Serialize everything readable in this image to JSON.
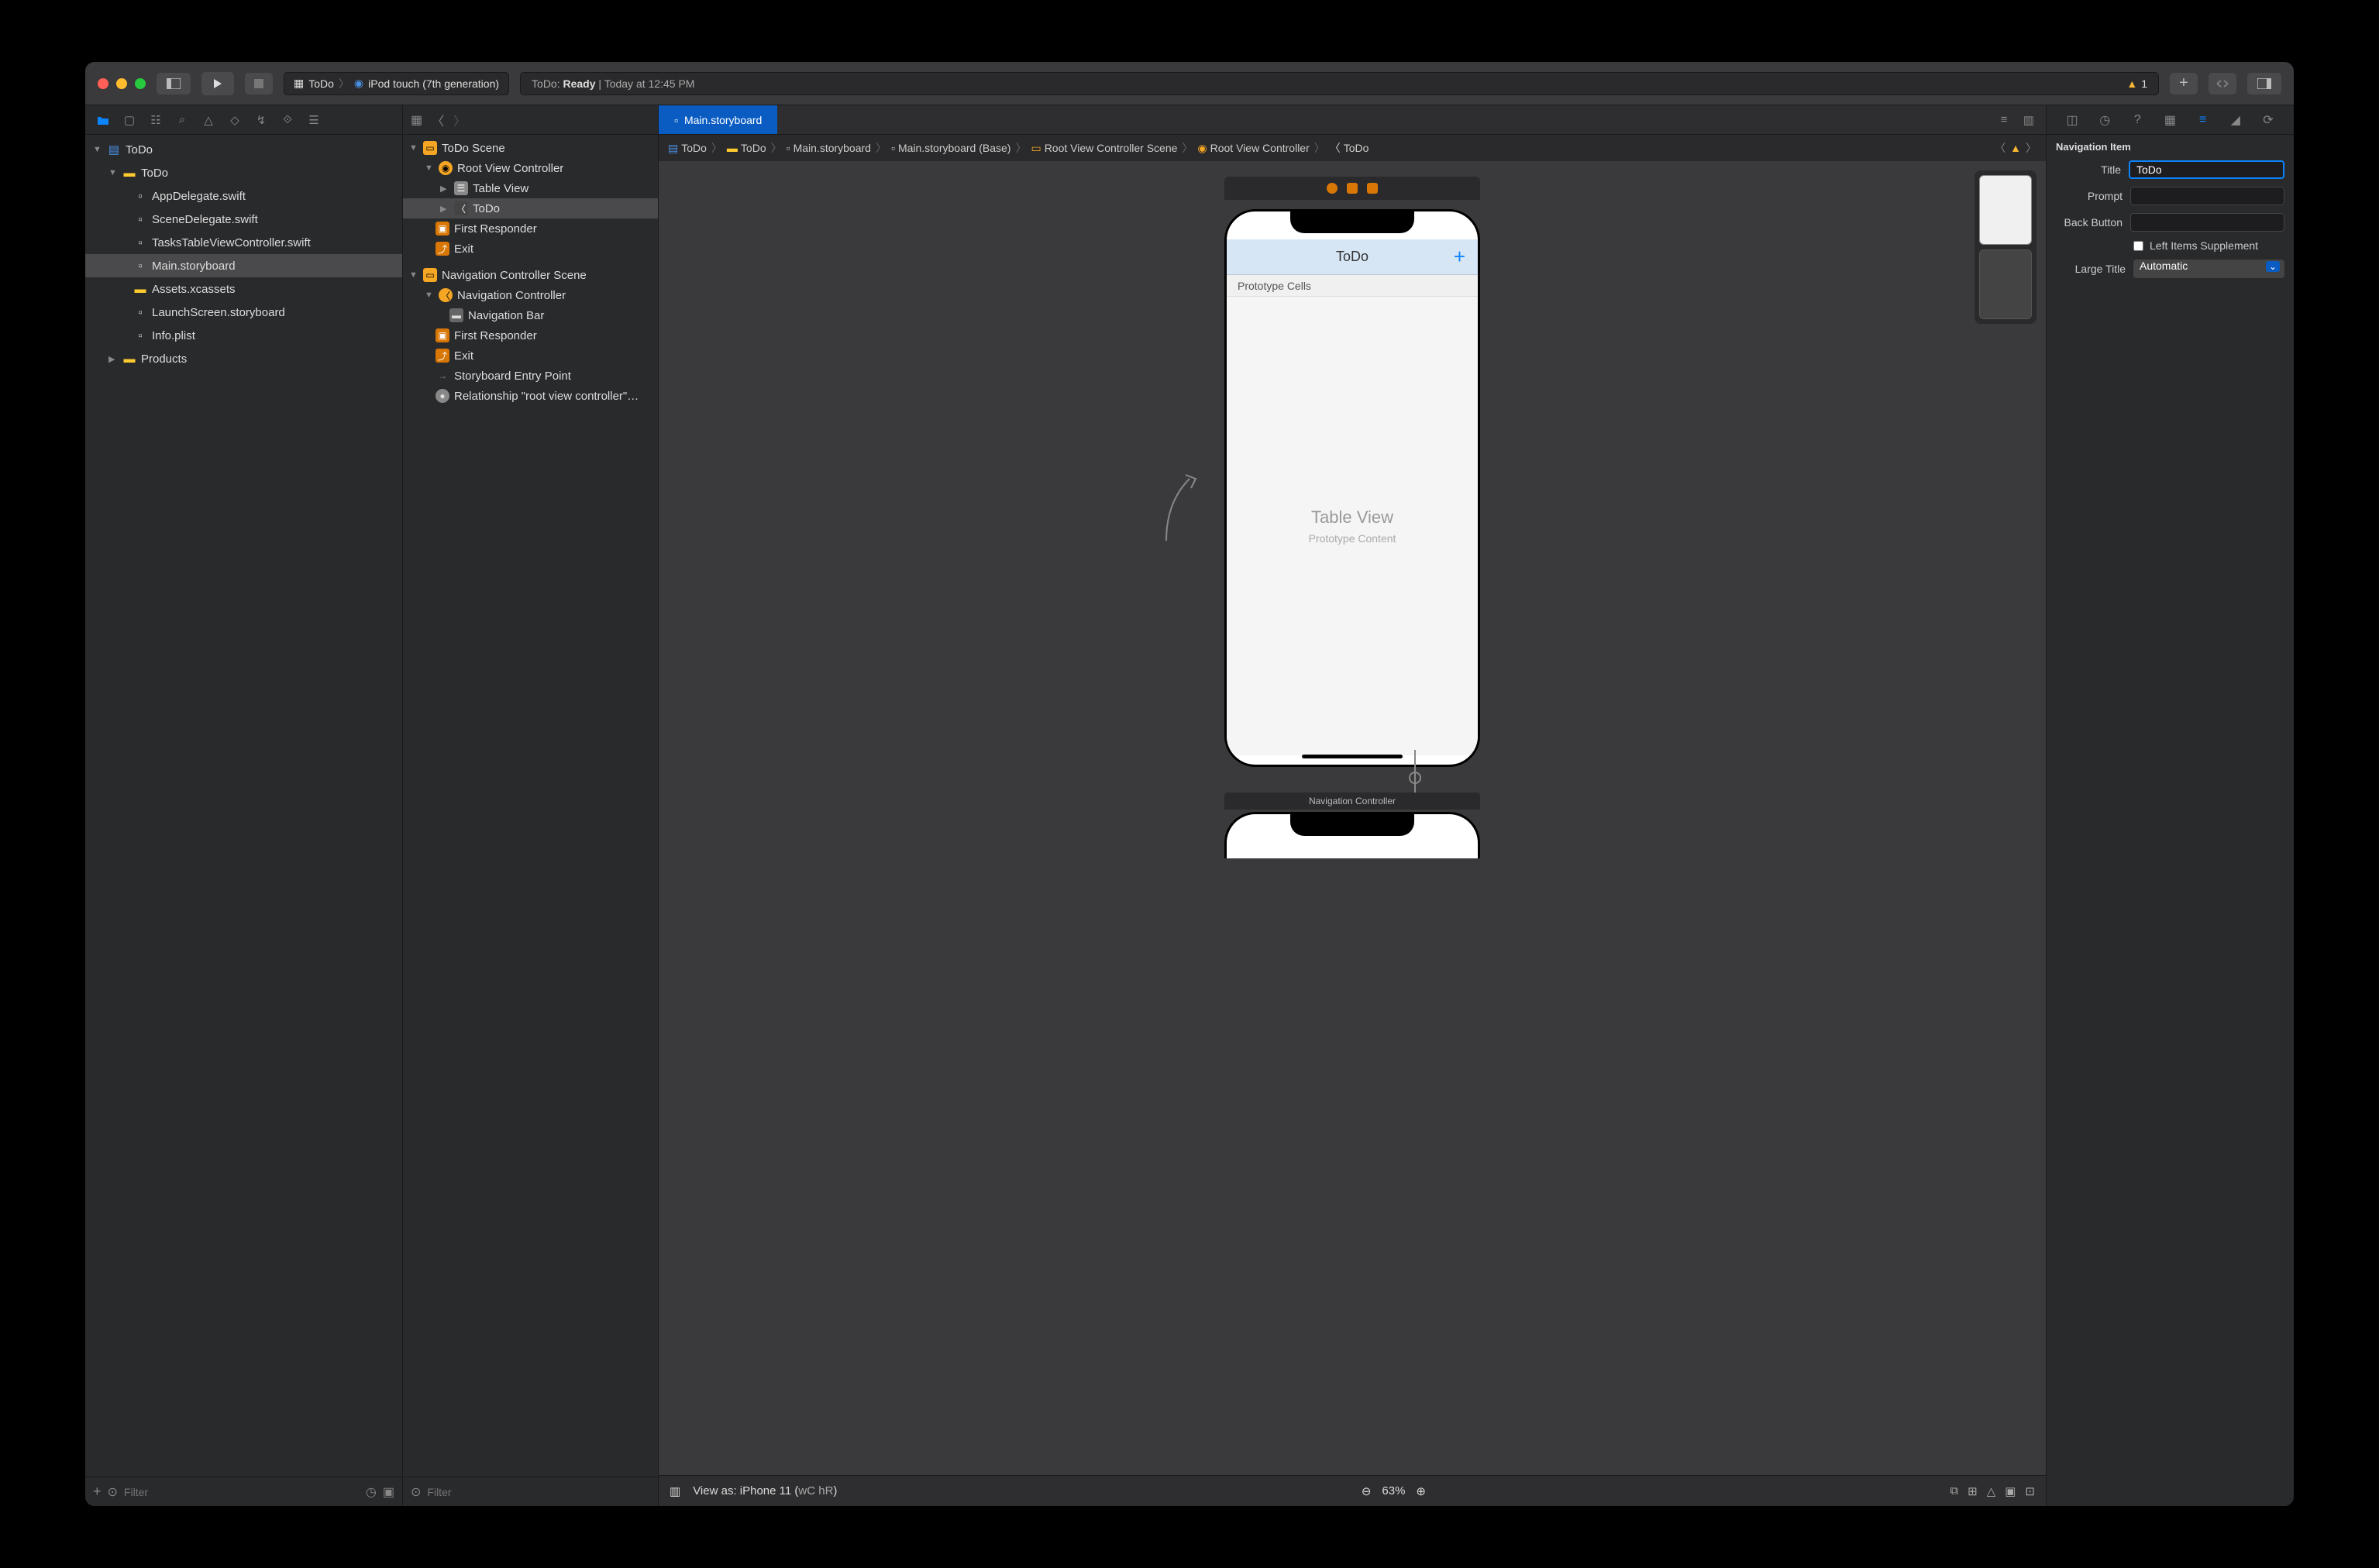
{
  "toolbar": {
    "scheme_project": "ToDo",
    "scheme_device": "iPod touch (7th generation)",
    "status_app": "ToDo:",
    "status_state": "Ready",
    "status_sep": "|",
    "status_time": "Today at 12:45 PM",
    "warning_count": "1"
  },
  "navigator": {
    "root": "ToDo",
    "group": "ToDo",
    "files": [
      "AppDelegate.swift",
      "SceneDelegate.swift",
      "TasksTableViewController.swift",
      "Main.storyboard",
      "Assets.xcassets",
      "LaunchScreen.storyboard",
      "Info.plist"
    ],
    "products": "Products",
    "filter_placeholder": "Filter"
  },
  "tabbar": {
    "active_tab": "Main.storyboard"
  },
  "jumpbar": {
    "crumbs": [
      "ToDo",
      "ToDo",
      "Main.storyboard",
      "Main.storyboard (Base)",
      "Root View Controller Scene",
      "Root View Controller",
      "ToDo"
    ]
  },
  "outline": {
    "scene1": "ToDo Scene",
    "vc1": "Root View Controller",
    "tv": "Table View",
    "navitem": "ToDo",
    "fr1": "First Responder",
    "exit1": "Exit",
    "scene2": "Navigation Controller Scene",
    "navctrl": "Navigation Controller",
    "navbar": "Navigation Bar",
    "fr2": "First Responder",
    "exit2": "Exit",
    "entry": "Storyboard Entry Point",
    "rel": "Relationship \"root view controller\"…",
    "filter_placeholder": "Filter"
  },
  "canvas": {
    "nav_title": "ToDo",
    "proto_cells": "Prototype Cells",
    "tv_label": "Table View",
    "tv_sub": "Prototype Content",
    "navctrl_label": "Navigation Controller",
    "footer_view": "View as: iPhone 11 (",
    "footer_wc": "wC",
    "footer_hr": "hR",
    "footer_close": ")",
    "zoom": "63%"
  },
  "inspector": {
    "section": "Navigation Item",
    "title_label": "Title",
    "title_value": "ToDo",
    "prompt_label": "Prompt",
    "back_label": "Back Button",
    "left_items": "Left Items Supplement",
    "large_title_label": "Large Title",
    "large_title_value": "Automatic"
  }
}
